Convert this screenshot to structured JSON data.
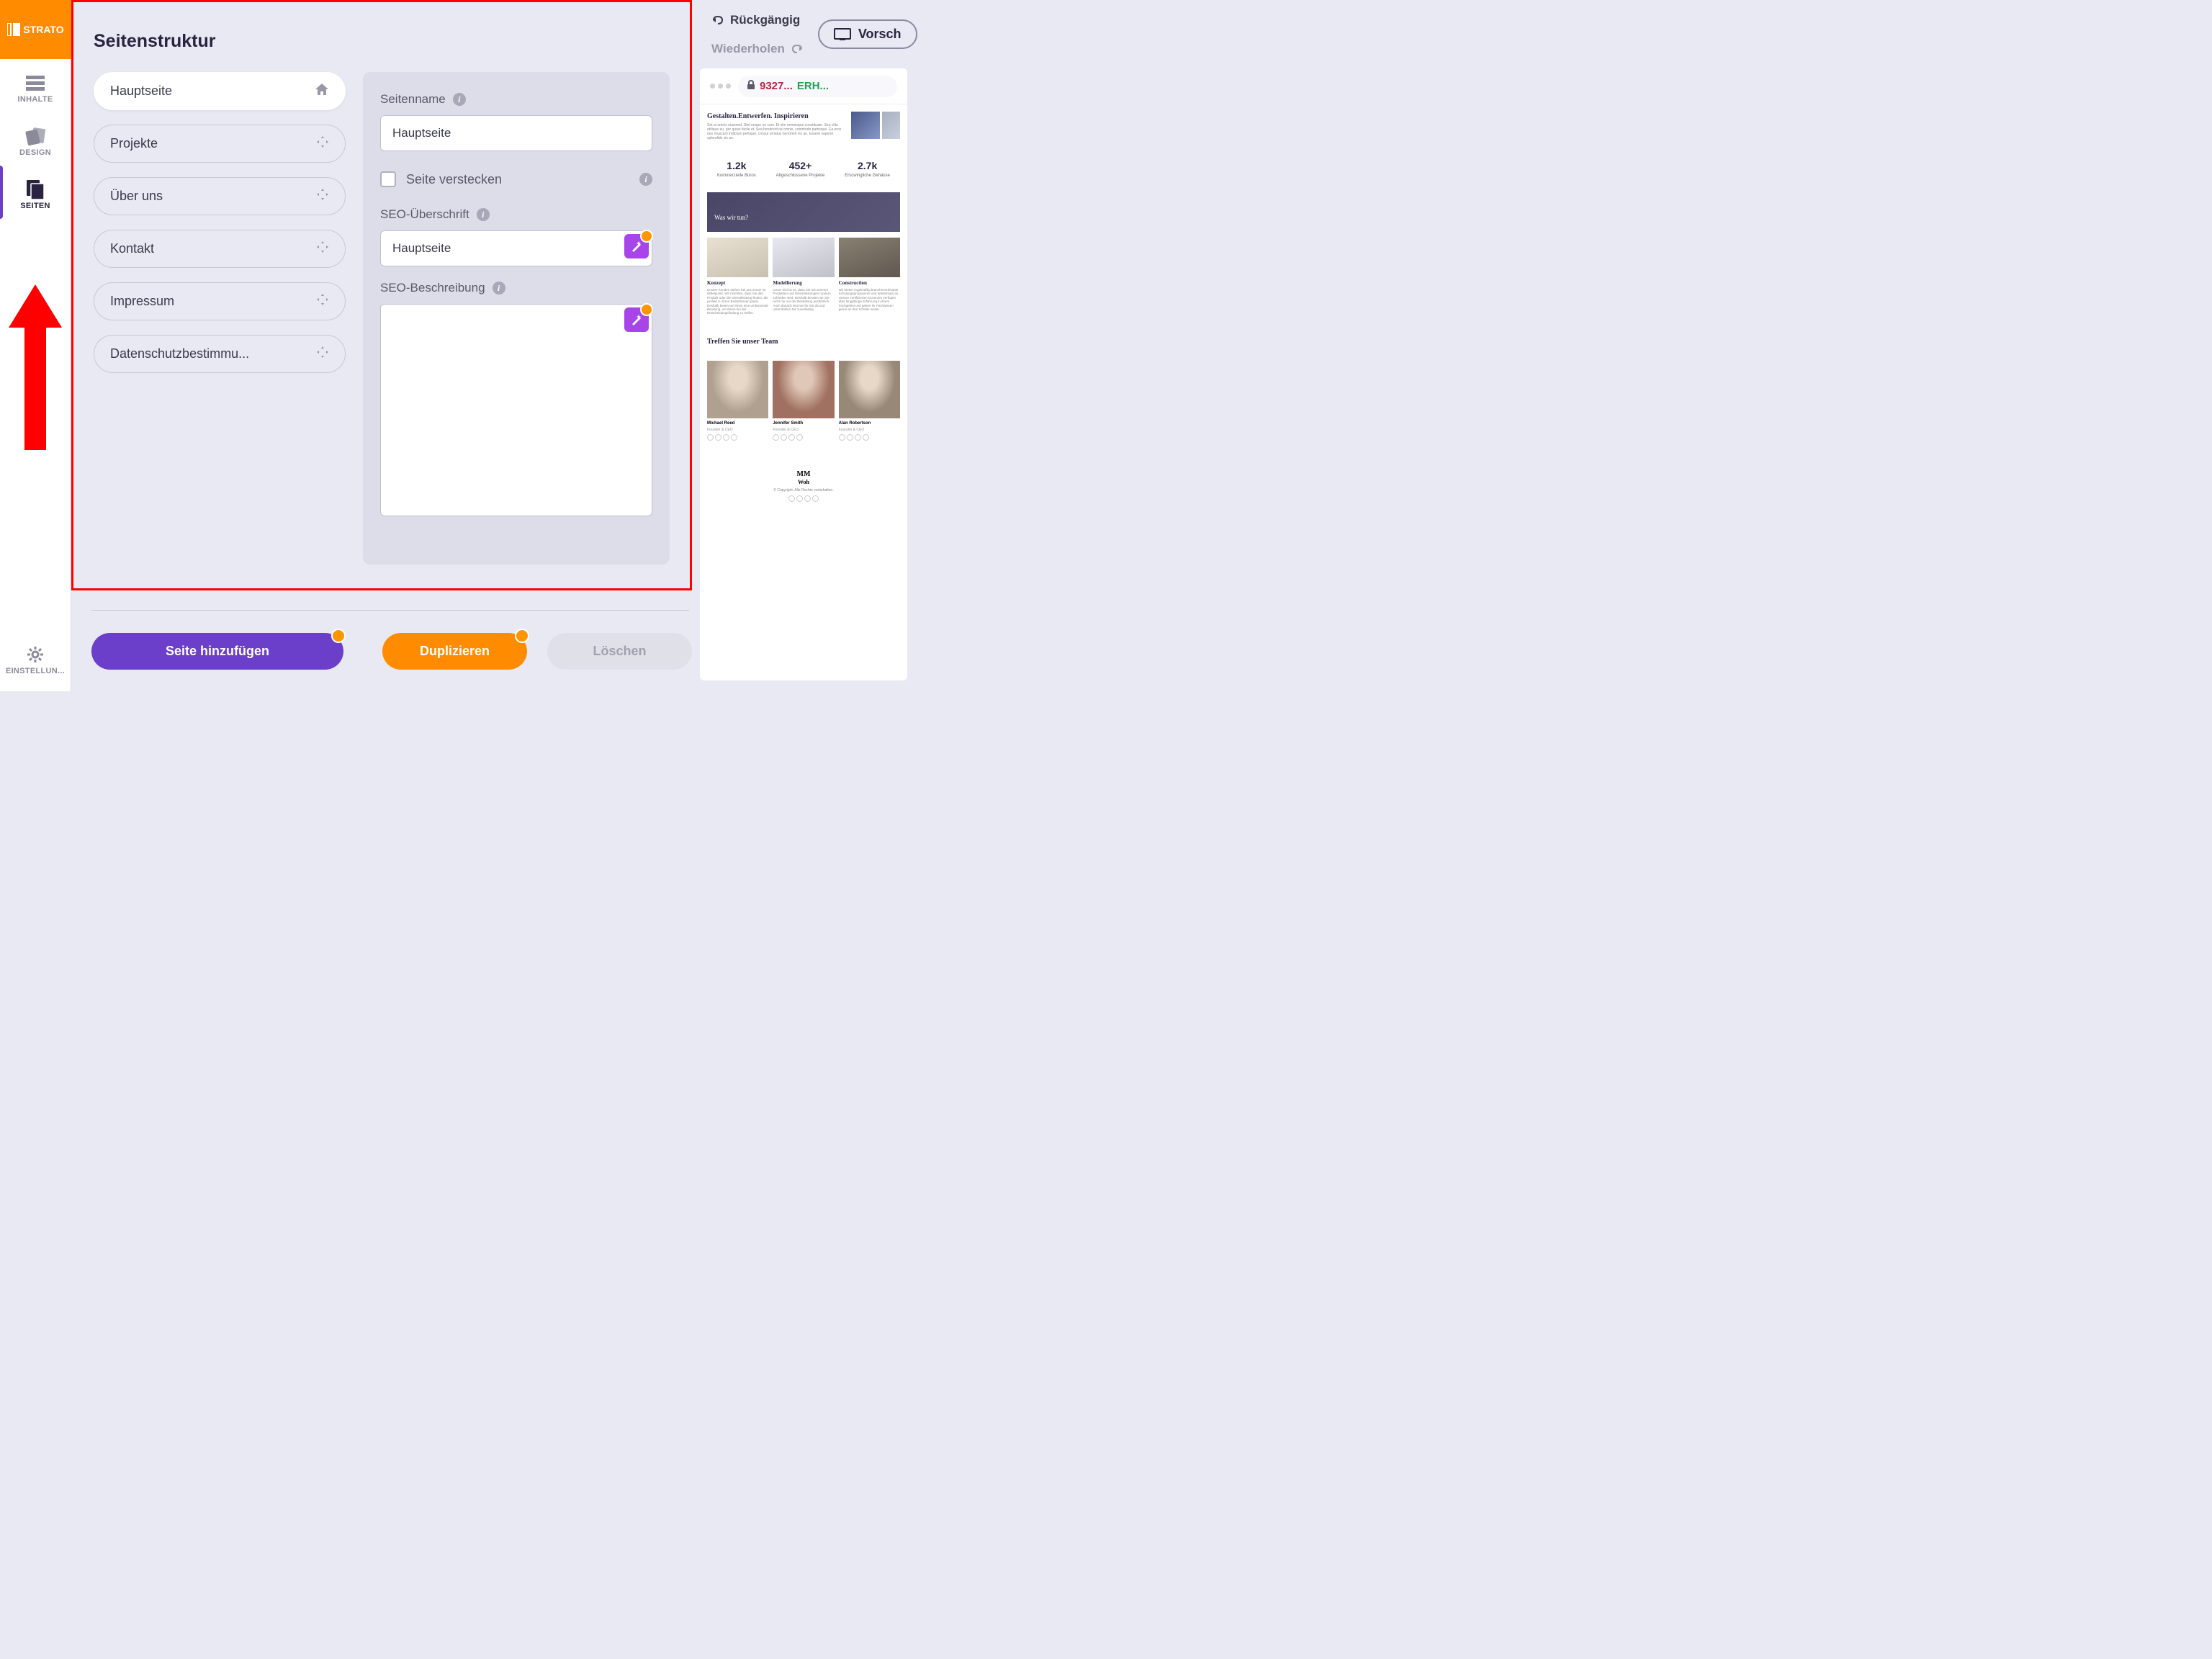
{
  "logo_text": "STRATO",
  "sidebar": {
    "items": [
      {
        "label": "INHALTE"
      },
      {
        "label": "DESIGN"
      },
      {
        "label": "SEITEN"
      },
      {
        "label": "EINSTELLUN..."
      }
    ]
  },
  "toolbar": {
    "undo": "Rückgängig",
    "redo": "Wiederholen",
    "preview": "Vorsch"
  },
  "panel": {
    "title": "Seitenstruktur",
    "pages": [
      {
        "label": "Hauptseite",
        "active": true,
        "icon": "home"
      },
      {
        "label": "Projekte",
        "active": false,
        "icon": "move"
      },
      {
        "label": "Über uns",
        "active": false,
        "icon": "move"
      },
      {
        "label": "Kontakt",
        "active": false,
        "icon": "move"
      },
      {
        "label": "Impressum",
        "active": false,
        "icon": "move"
      },
      {
        "label": "Datenschutzbestimmu...",
        "active": false,
        "icon": "move"
      }
    ],
    "detail": {
      "name_label": "Seitenname",
      "name_value": "Hauptseite",
      "hide_label": "Seite verstecken",
      "seo_title_label": "SEO-Überschrift",
      "seo_title_value": "Hauptseite",
      "seo_desc_label": "SEO-Beschreibung",
      "seo_desc_value": ""
    }
  },
  "buttons": {
    "add_page": "Seite hinzufügen",
    "duplicate": "Duplizieren",
    "delete": "Löschen"
  },
  "preview": {
    "url_num": "9327...",
    "url_status": "ERH...",
    "hero_title": "Gestalten.Entwerfen. Inspirieren",
    "hero_lorem": "Set ut omnis eiusmod. Stet neque no cum. Et vim omnesque constituam. Sea clita oblique eu, per quasi facile et. Sea hendrerit ne omnis, commodo patrisque. Ea eros duo muscam indictum pertique, consul ornatus hendrerit vis an. Iuvaret saperet splendide vis an.",
    "stats": [
      {
        "num": "1.2k",
        "label": "Kommerzielle Büros"
      },
      {
        "num": "452+",
        "label": "Abgeschlossene Projekte"
      },
      {
        "num": "2.7k",
        "label": "Erscwingliche Gehäuse"
      }
    ],
    "what_we_do": "Was wir tun?",
    "cards": [
      {
        "title": "Konzept",
        "text": "Unsere Kunden stehen bei uns immer im Mittelpunkt. Wir möchten, dass Sie das Produkt oder die Dienstleistung finden, die perfekt zu Ihren Bedürfnissen passt. Deshalb bieten wir Ihnen eine umfassende Beratung, um Ihnen bei der Entscheidungsfindung zu helfen."
      },
      {
        "title": "Modellierung",
        "text": "Unser Ziel ist es, dass Sie mit unseren Produkten und Dienstleistungen rundum zufrieden sind. Deshalb beraten wir Sie nicht nur vor der Bestellung ausführlich. Auch danach sind wir für Sie da und unterstützen Sie zuverlässig."
      },
      {
        "title": "Construction",
        "text": "Wir bieten regelmäßig branchenrelevante Schulungsprogramme und Workshops an. Unsere zertifizierten Dozenten verfügen über langjährige Erfahrung in ihrem Fachgebiet und geben ihr Fachwissen gerne an ihre Schüler weiter."
      }
    ],
    "team_title": "Treffen Sie unser Team",
    "team": [
      {
        "name": "Michael Reed",
        "role": "Founder & CEO"
      },
      {
        "name": "Jennifer Smith",
        "role": "Founder & CEO"
      },
      {
        "name": "Alan Robertson",
        "role": "Founder & CEO"
      }
    ],
    "footer_logo": "MM",
    "footer_sub": "Woh",
    "footer_copyright": "© Copyright. Alle Rechte vorbehalten."
  }
}
